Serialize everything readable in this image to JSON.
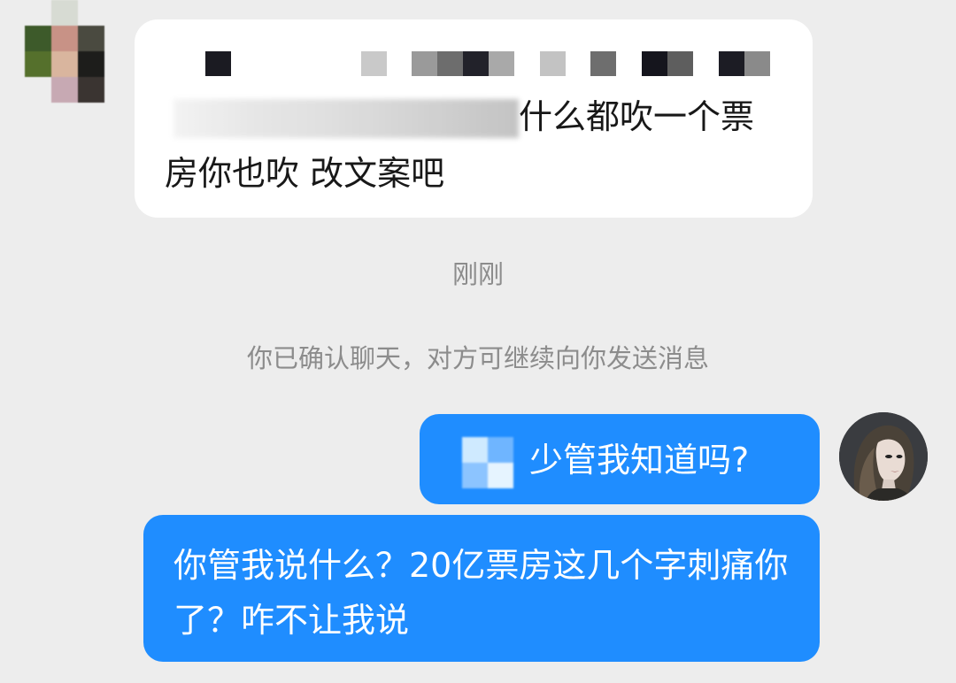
{
  "conversation": {
    "incoming": {
      "line1_visible": "什么都吹一个票",
      "line2": "房你也吹 改文案吧"
    },
    "time_label": "刚刚",
    "system_notice": "你已确认聊天，对方可继续向你发送消息",
    "outgoing": [
      {
        "text": "少管我知道吗?"
      },
      {
        "text": "你管我说什么？20亿票房这几个字刺痛你了？咋不让我说"
      }
    ]
  },
  "icons": {
    "left_avatar": "pixelated-avatar-icon",
    "right_avatar": "user-avatar-icon"
  },
  "colors": {
    "background": "#ededed",
    "incoming_bubble": "#ffffff",
    "outgoing_bubble": "#1f8dff",
    "system_text": "#8c8c8c"
  }
}
